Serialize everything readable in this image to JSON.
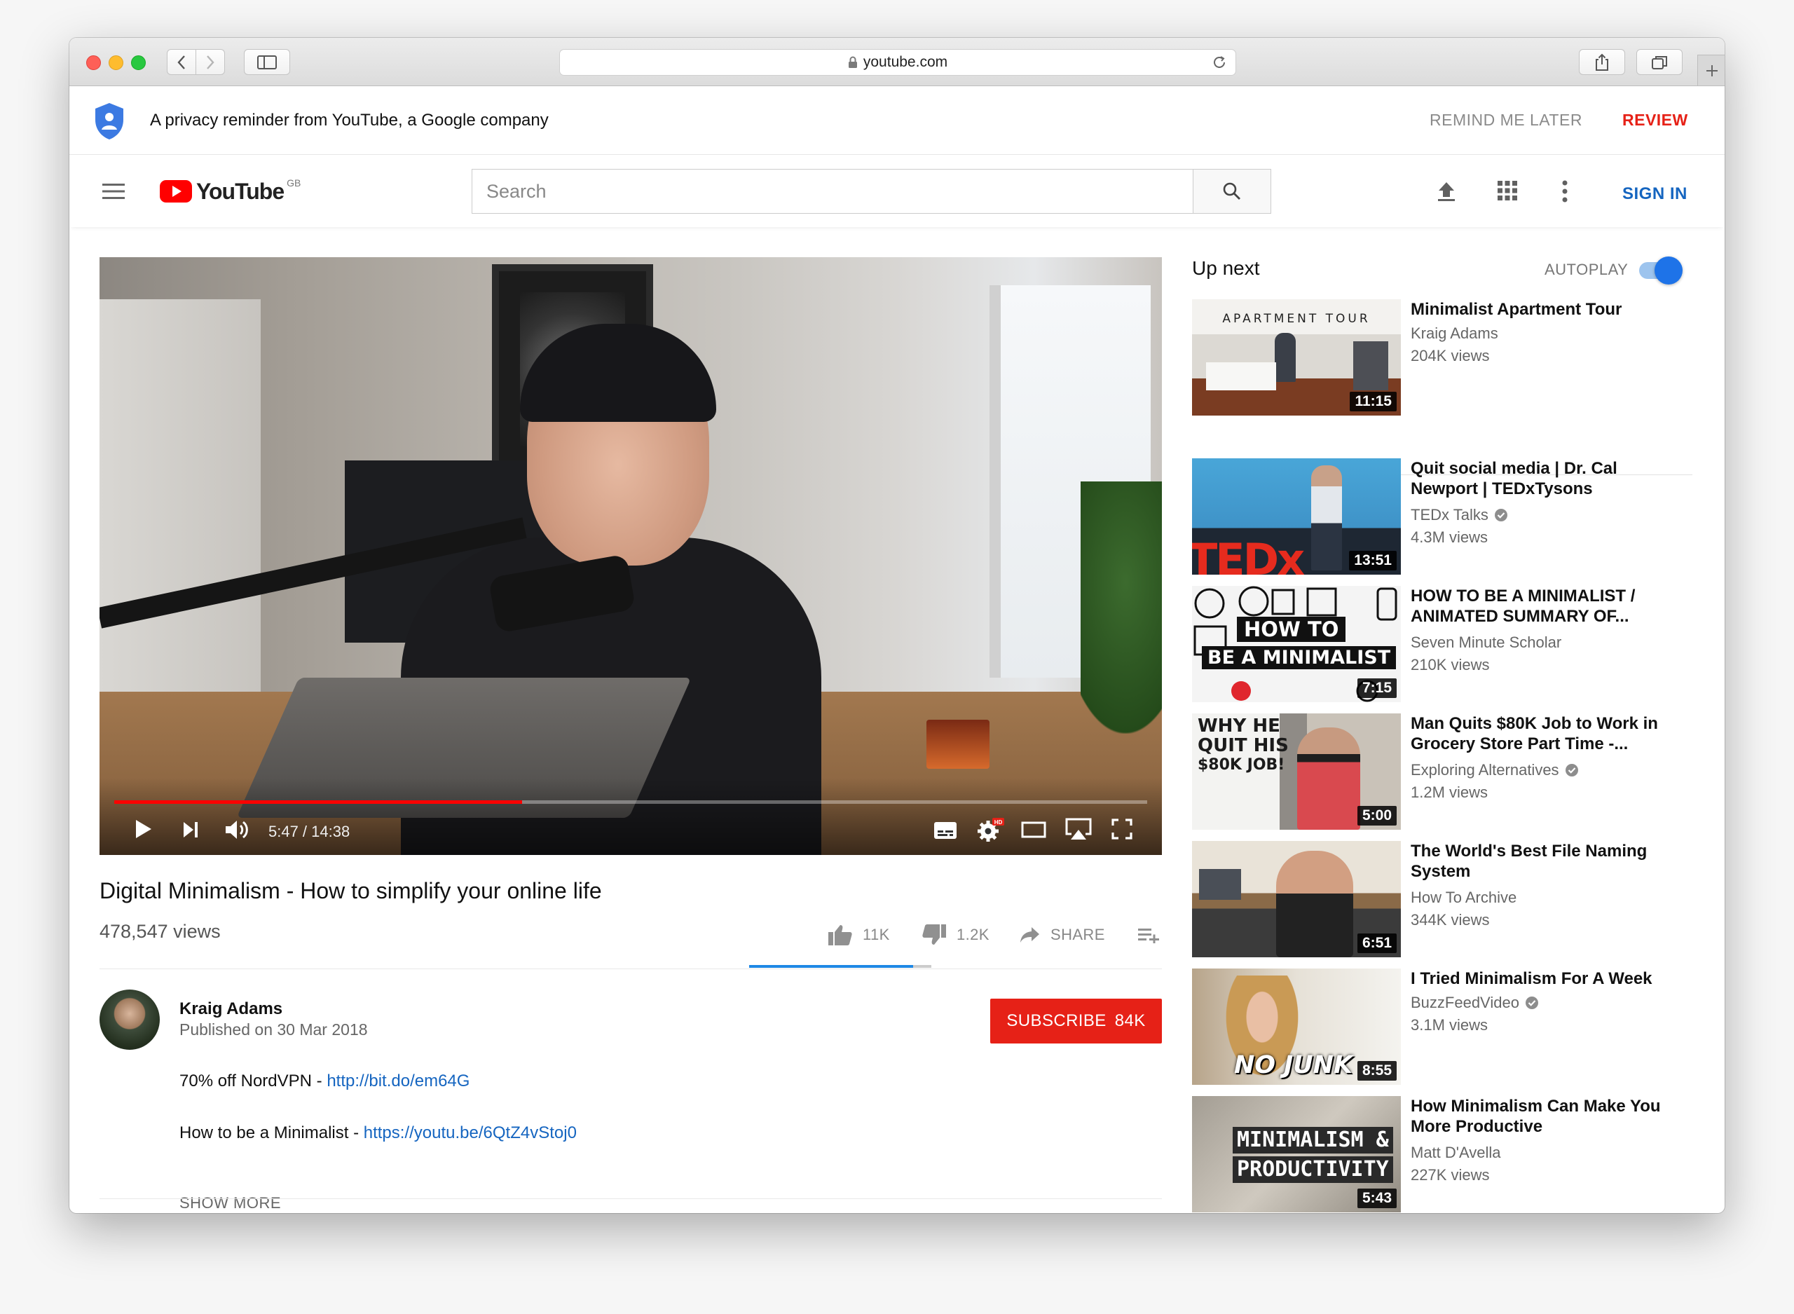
{
  "browser": {
    "url": "youtube.com"
  },
  "privacy": {
    "message": "A privacy reminder from YouTube, a Google company",
    "remind_label": "REMIND ME LATER",
    "review_label": "REVIEW"
  },
  "header": {
    "logo_text": "YouTube",
    "region": "GB",
    "search_placeholder": "Search",
    "signin_label": "SIGN IN"
  },
  "player": {
    "time": "5:47 / 14:38",
    "progress_fraction": 0.395
  },
  "video": {
    "title": "Digital Minimalism - How to simplify your online life",
    "views": "478,547 views",
    "likes": "11K",
    "dislikes": "1.2K",
    "share_label": "SHARE",
    "like_fraction": 0.9
  },
  "channel": {
    "name": "Kraig Adams",
    "published": "Published on 30 Mar 2018",
    "subscribe_label": "SUBSCRIBE",
    "subscriber_count": "84K"
  },
  "description": {
    "line1_text": "70% off NordVPN - ",
    "line1_link": "http://bit.do/em64G",
    "line2_text": "How to be a Minimalist - ",
    "line2_link": "https://youtu.be/6QtZ4vStoj0",
    "show_more": "SHOW MORE"
  },
  "sidebar": {
    "up_next": "Up next",
    "autoplay_label": "AUTOPLAY",
    "items": [
      {
        "title": "Minimalist Apartment Tour",
        "channel": "Kraig Adams",
        "verified": false,
        "views": "204K views",
        "duration": "11:15",
        "thumb_text": "APARTMENT TOUR"
      },
      {
        "title": "Quit social media | Dr. Cal Newport | TEDxTysons",
        "channel": "TEDx Talks",
        "verified": true,
        "views": "4.3M views",
        "duration": "13:51",
        "thumb_text": "TEDx"
      },
      {
        "title": "HOW TO BE A MINIMALIST / ANIMATED SUMMARY OF...",
        "channel": "Seven Minute Scholar",
        "verified": false,
        "views": "210K views",
        "duration": "7:15",
        "thumb_text_1": "HOW TO",
        "thumb_text_2": "BE A MINIMALIST"
      },
      {
        "title": "Man Quits $80K Job to Work in Grocery Store Part Time -...",
        "channel": "Exploring Alternatives",
        "verified": true,
        "views": "1.2M views",
        "duration": "5:00",
        "thumb_text_1": "WHY HE",
        "thumb_text_2": "QUIT HIS",
        "thumb_text_3": "$80K JOB!"
      },
      {
        "title": "The World's Best File Naming System",
        "channel": "How To Archive",
        "verified": false,
        "views": "344K views",
        "duration": "6:51"
      },
      {
        "title": "I Tried Minimalism For A Week",
        "channel": "BuzzFeedVideo",
        "verified": true,
        "views": "3.1M views",
        "duration": "8:55",
        "thumb_text": "NO JUNK"
      },
      {
        "title": "How Minimalism Can Make You More Productive",
        "channel": "Matt D'Avella",
        "verified": false,
        "views": "227K views",
        "duration": "5:43",
        "thumb_text_1": "MINIMALISM &",
        "thumb_text_2": "PRODUCTIVITY"
      }
    ]
  },
  "colors": {
    "brand_red": "#e62117",
    "link_blue": "#1565c0",
    "toggle_blue": "#1e73e8"
  }
}
